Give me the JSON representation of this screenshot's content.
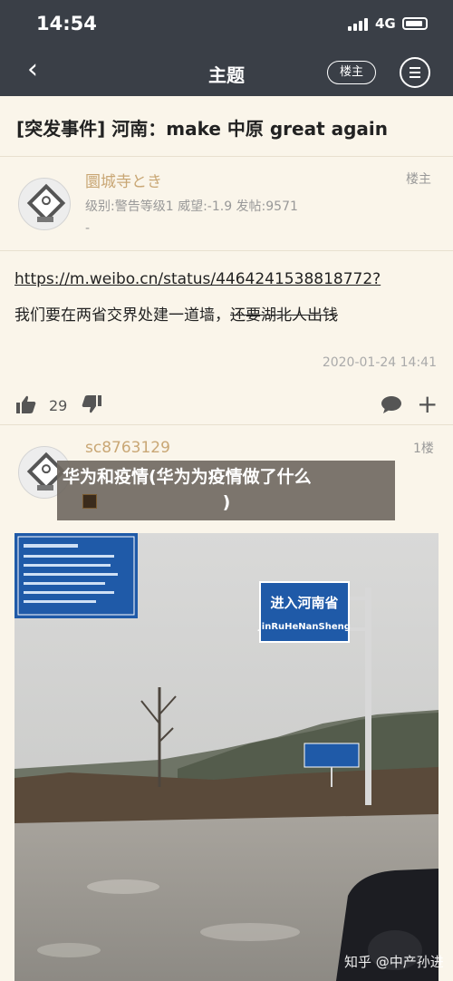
{
  "status_bar": {
    "time": "14:54",
    "network": "4G"
  },
  "nav": {
    "title": "主题",
    "louzhu_button": "楼主"
  },
  "thread": {
    "title": "[突发事件] 河南：make 中原 great again"
  },
  "post1": {
    "username": "圜城寺とき",
    "floor": "楼主",
    "meta": "级别:警告等级1  威望:-1.9  发帖:9571",
    "meta2": "-",
    "link": "https://m.weibo.cn/status/4464241538818772?",
    "body": "我们要在两省交界处建一道墙，",
    "body_strike": "还要湖北人出钱",
    "date": "2020-01-24 14:41",
    "likes": "29"
  },
  "post2": {
    "username": "sc8763129",
    "floor": "1楼"
  },
  "photo": {
    "sign_main_cn": "进入河南省",
    "sign_main_py": "JinRuHeNanSheng"
  },
  "overlay": {
    "title_line1": "华为和疫情(华为为疫情做了什么",
    "title_line2": ")"
  },
  "watermark": "知乎 @中产孙进"
}
